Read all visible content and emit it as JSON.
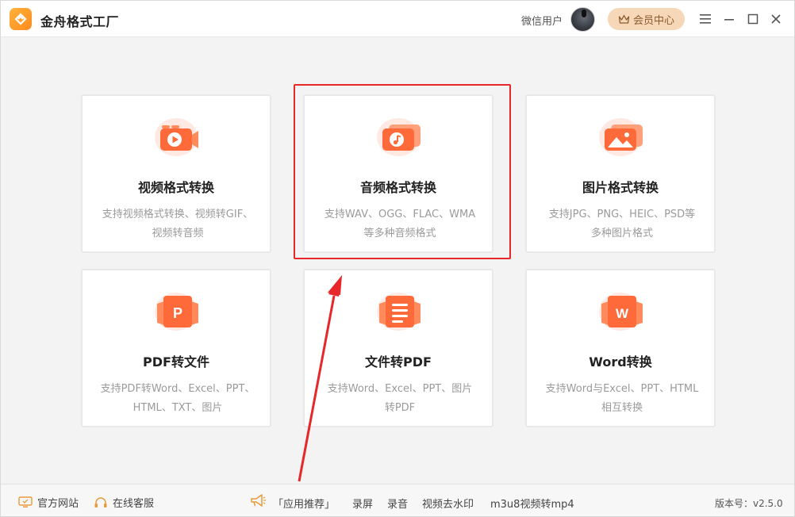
{
  "app": {
    "title": "金舟格式工厂"
  },
  "header": {
    "user_name": "微信用户",
    "vip_label": "会员中心"
  },
  "cards": [
    {
      "title": "视频格式转换",
      "desc": [
        "支持视频格式转换、视频转GIF、",
        "视频转音频"
      ]
    },
    {
      "title": "音频格式转换",
      "desc": [
        "支持WAV、OGG、FLAC、WMA",
        "等多种音频格式"
      ]
    },
    {
      "title": "图片格式转换",
      "desc": [
        "支持JPG、PNG、HEIC、PSD等",
        "多种图片格式"
      ]
    },
    {
      "title": "PDF转文件",
      "desc": [
        "支持PDF转Word、Excel、PPT、",
        "HTML、TXT、图片"
      ]
    },
    {
      "title": "文件转PDF",
      "desc": [
        "支持Word、Excel、PPT、图片",
        "转PDF"
      ]
    },
    {
      "title": "Word转换",
      "desc": [
        "支持Word与Excel、PPT、HTML",
        "相互转换"
      ]
    }
  ],
  "footer": {
    "website": "官方网站",
    "support": "在线客服",
    "recommend": "「应用推荐」",
    "screen_record": "录屏",
    "audio_record": "录音",
    "watermark": "视频去水印",
    "m3u8": "m3u8视频转mp4",
    "version": "版本号：v2.5.0"
  },
  "colors": {
    "accent_orange": "#ff6a3a",
    "highlight_red": "#e8272a",
    "vip_bg": "#f6d8b8"
  }
}
